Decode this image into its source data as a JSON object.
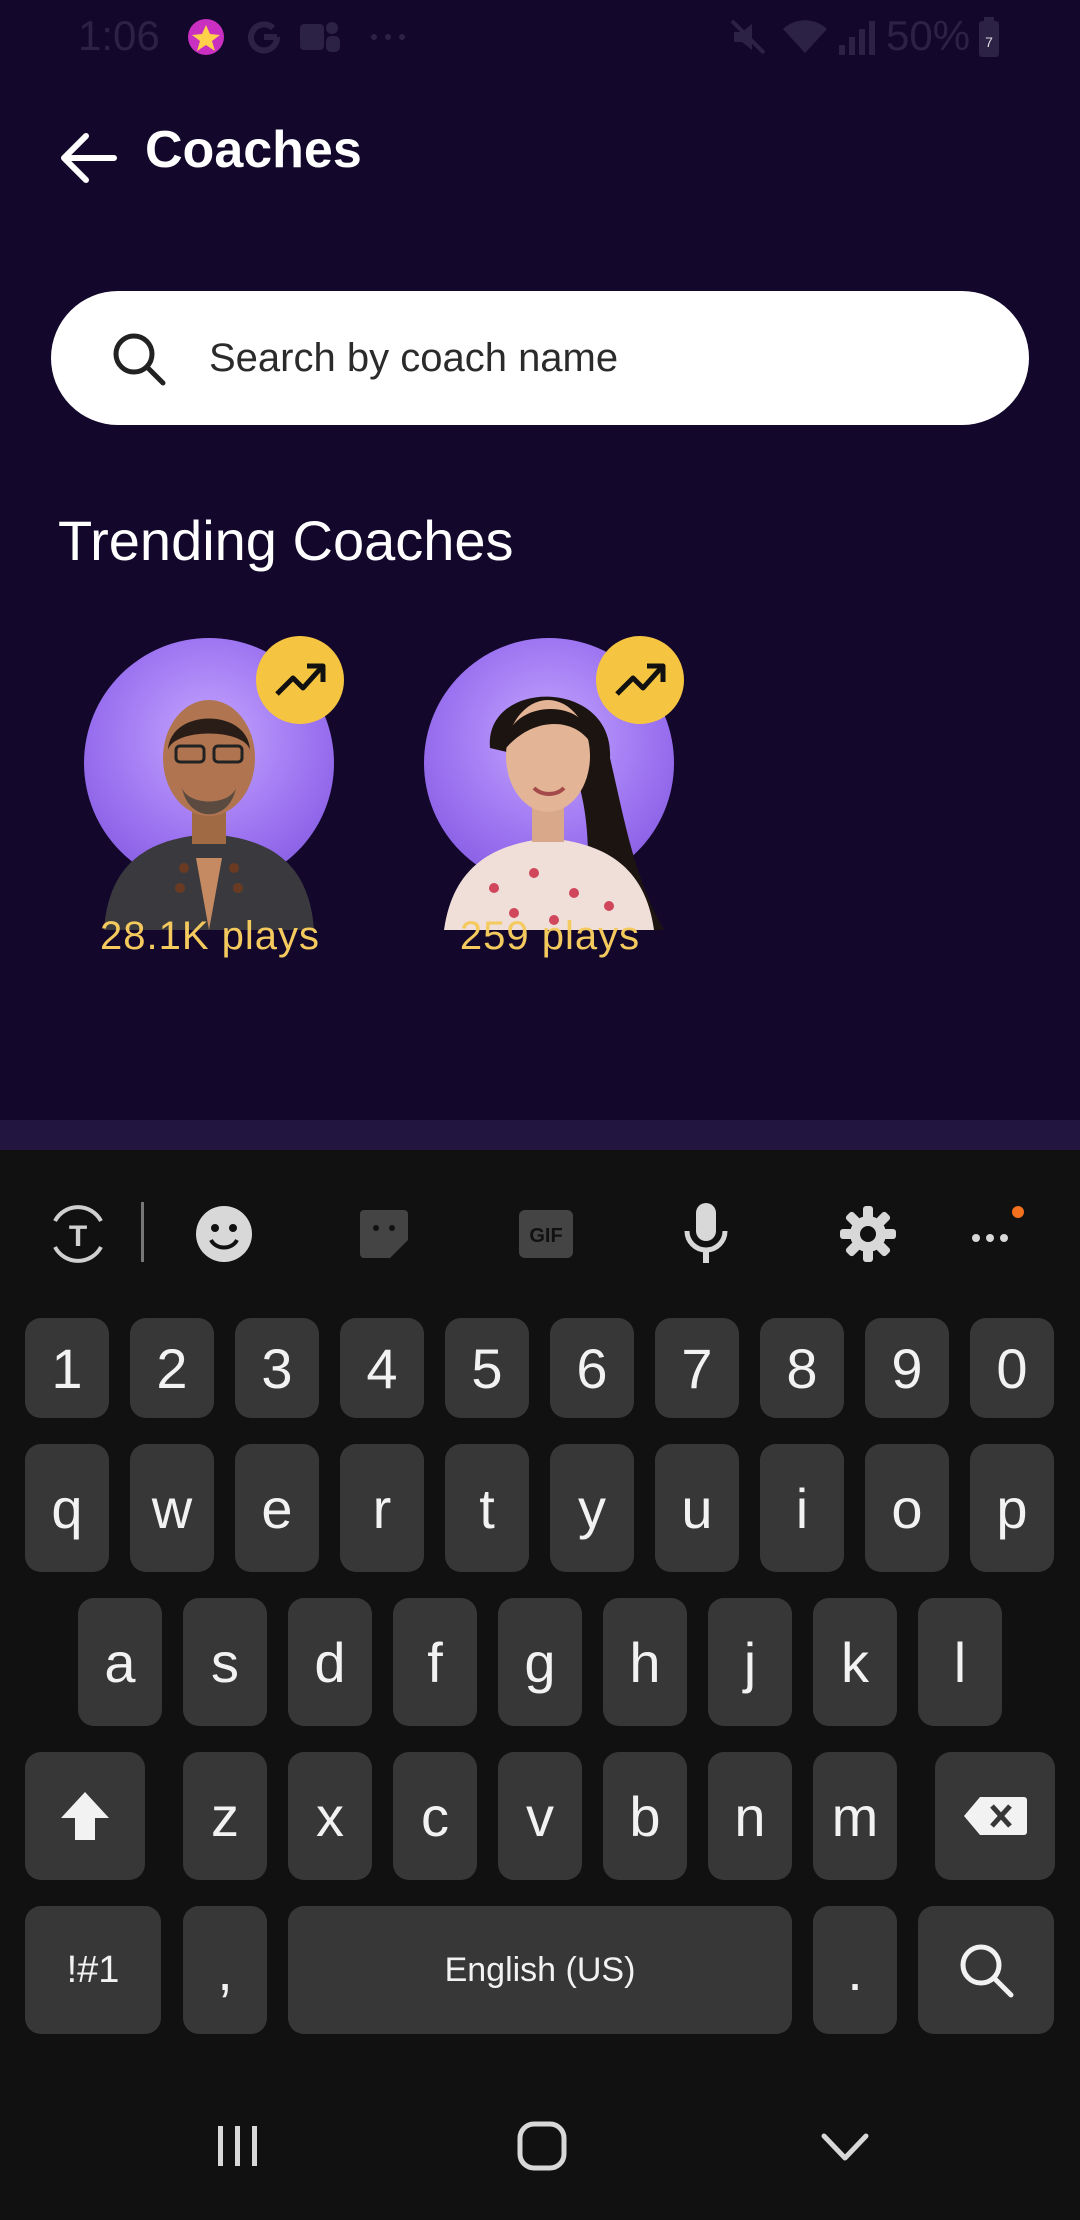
{
  "status_bar": {
    "time": "1:06",
    "battery": "50%",
    "battery_level": 7
  },
  "header": {
    "title": "Coaches"
  },
  "search": {
    "placeholder": "Search by coach name"
  },
  "trending": {
    "title": "Trending Coaches",
    "coaches": [
      {
        "plays": "28.1K plays"
      },
      {
        "plays": "259 plays"
      }
    ]
  },
  "keyboard": {
    "row_numbers": [
      "1",
      "2",
      "3",
      "4",
      "5",
      "6",
      "7",
      "8",
      "9",
      "0"
    ],
    "row1": [
      "q",
      "w",
      "e",
      "r",
      "t",
      "y",
      "u",
      "i",
      "o",
      "p"
    ],
    "row2": [
      "a",
      "s",
      "d",
      "f",
      "g",
      "h",
      "j",
      "k",
      "l"
    ],
    "row3": [
      "z",
      "x",
      "c",
      "v",
      "b",
      "n",
      "m"
    ],
    "symbols_label": "!#1",
    "comma": ",",
    "space_label": "English (US)",
    "period": ".",
    "toolbar": {
      "translate": "translate-icon",
      "emoji": "emoji-icon",
      "sticker": "sticker-icon",
      "gif_label": "GIF",
      "mic": "mic-icon",
      "settings": "settings-icon",
      "more": "more-icon"
    }
  },
  "colors": {
    "background": "#13082b",
    "accent_yellow": "#f5c542",
    "plays_text": "#f4c95d",
    "coach_circle": "#9b72f0",
    "keyboard_bg": "#111111",
    "key_bg": "#373737"
  }
}
